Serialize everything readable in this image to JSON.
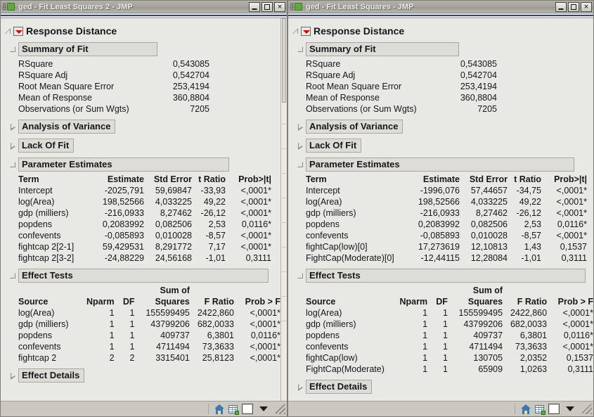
{
  "windows": [
    {
      "id": "left",
      "title": "ged - Fit Least Squares 2 - JMP",
      "root_label": "Response Distance",
      "summary": {
        "header": "Summary of Fit",
        "rows": [
          {
            "label": "RSquare",
            "value": "0,543085"
          },
          {
            "label": "RSquare Adj",
            "value": "0,542704"
          },
          {
            "label": "Root Mean Square Error",
            "value": "253,4194"
          },
          {
            "label": "Mean of Response",
            "value": "360,8804"
          },
          {
            "label": "Observations (or Sum Wgts)",
            "value": "7205"
          }
        ]
      },
      "anova_header": "Analysis of Variance",
      "lackoffit_header": "Lack Of Fit",
      "parameter_estimates": {
        "header": "Parameter Estimates",
        "columns": [
          "Term",
          "Estimate",
          "Std Error",
          "t Ratio",
          "Prob>|t|"
        ],
        "rows": [
          [
            "Intercept",
            "-2025,791",
            "59,69847",
            "-33,93",
            "<,0001*"
          ],
          [
            "log(Area)",
            "198,52566",
            "4,033225",
            "49,22",
            "<,0001*"
          ],
          [
            "gdp (milliers)",
            "-216,0933",
            "8,27462",
            "-26,12",
            "<,0001*"
          ],
          [
            "popdens",
            "0,2083992",
            "0,082506",
            "2,53",
            "0,0116*"
          ],
          [
            "confevents",
            "-0,085893",
            "0,010028",
            "-8,57",
            "<,0001*"
          ],
          [
            "fightcap 2[2-1]",
            "59,429531",
            "8,291772",
            "7,17",
            "<,0001*"
          ],
          [
            "fightcap 2[3-2]",
            "-24,88229",
            "24,56168",
            "-1,01",
            "0,3111"
          ]
        ]
      },
      "effect_tests": {
        "header": "Effect Tests",
        "sumof_label": "Sum of",
        "columns": [
          "Source",
          "Nparm",
          "DF",
          "Squares",
          "F Ratio",
          "Prob > F"
        ],
        "rows": [
          [
            "log(Area)",
            "1",
            "1",
            "155599495",
            "2422,860",
            "<,0001*"
          ],
          [
            "gdp (milliers)",
            "1",
            "1",
            "43799206",
            "682,0033",
            "<,0001*"
          ],
          [
            "popdens",
            "1",
            "1",
            "409737",
            "6,3801",
            "0,0116*"
          ],
          [
            "confevents",
            "1",
            "1",
            "4711494",
            "73,3633",
            "<,0001*"
          ],
          [
            "fightcap 2",
            "2",
            "2",
            "3315401",
            "25,8123",
            "<,0001*"
          ]
        ]
      },
      "effect_details_header": "Effect Details"
    },
    {
      "id": "right",
      "title": "ged - Fit Least Squares - JMP",
      "root_label": "Response Distance",
      "summary": {
        "header": "Summary of Fit",
        "rows": [
          {
            "label": "RSquare",
            "value": "0,543085"
          },
          {
            "label": "RSquare Adj",
            "value": "0,542704"
          },
          {
            "label": "Root Mean Square Error",
            "value": "253,4194"
          },
          {
            "label": "Mean of Response",
            "value": "360,8804"
          },
          {
            "label": "Observations (or Sum Wgts)",
            "value": "7205"
          }
        ]
      },
      "anova_header": "Analysis of Variance",
      "lackoffit_header": "Lack Of Fit",
      "parameter_estimates": {
        "header": "Parameter Estimates",
        "columns": [
          "Term",
          "Estimate",
          "Std Error",
          "t Ratio",
          "Prob>|t|"
        ],
        "rows": [
          [
            "Intercept",
            "-1996,076",
            "57,44657",
            "-34,75",
            "<,0001*"
          ],
          [
            "log(Area)",
            "198,52566",
            "4,033225",
            "49,22",
            "<,0001*"
          ],
          [
            "gdp (milliers)",
            "-216,0933",
            "8,27462",
            "-26,12",
            "<,0001*"
          ],
          [
            "popdens",
            "0,2083992",
            "0,082506",
            "2,53",
            "0,0116*"
          ],
          [
            "confevents",
            "-0,085893",
            "0,010028",
            "-8,57",
            "<,0001*"
          ],
          [
            "fightCap(low)[0]",
            "17,273619",
            "12,10813",
            "1,43",
            "0,1537"
          ],
          [
            "FightCap(Moderate)[0]",
            "-12,44115",
            "12,28084",
            "-1,01",
            "0,3111"
          ]
        ]
      },
      "effect_tests": {
        "header": "Effect Tests",
        "sumof_label": "Sum of",
        "columns": [
          "Source",
          "Nparm",
          "DF",
          "Squares",
          "F Ratio",
          "Prob > F"
        ],
        "rows": [
          [
            "log(Area)",
            "1",
            "1",
            "155599495",
            "2422,860",
            "<,0001*"
          ],
          [
            "gdp (milliers)",
            "1",
            "1",
            "43799206",
            "682,0033",
            "<,0001*"
          ],
          [
            "popdens",
            "1",
            "1",
            "409737",
            "6,3801",
            "0,0116*"
          ],
          [
            "confevents",
            "1",
            "1",
            "4711494",
            "73,3633",
            "<,0001*"
          ],
          [
            "fightCap(low)",
            "1",
            "1",
            "130705",
            "2,0352",
            "0,1537"
          ],
          [
            "FightCap(Moderate)",
            "1",
            "1",
            "65909",
            "1,0263",
            "0,3111"
          ]
        ]
      },
      "effect_details_header": "Effect Details"
    }
  ],
  "window_buttons": {
    "minimize": "_",
    "maximize": "□",
    "close": "✕"
  },
  "statusbar": {
    "icons": [
      "home-icon",
      "data-table-icon",
      "white-square-icon",
      "down-caret-icon",
      "resize-grip-icon"
    ]
  },
  "colors": {
    "titlebar": "#a7a59e",
    "accent_blue": "#2f3f96",
    "panel_bg": "#e8e8e4",
    "header_box": "#dedcd7",
    "red_triangle": "#d40000",
    "status_bg": "#cbc8c1"
  }
}
